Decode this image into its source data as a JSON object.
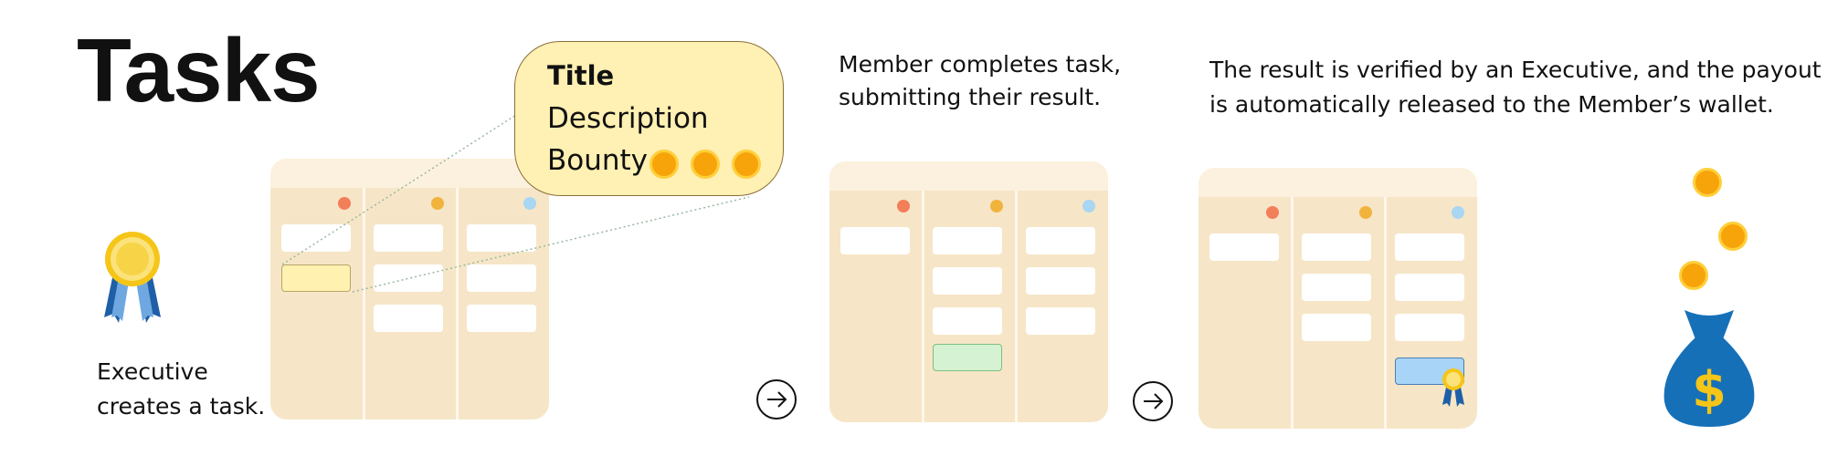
{
  "title": "Tasks",
  "step1": {
    "caption_line1": "Executive",
    "caption_line2": "creates a task."
  },
  "popup": {
    "title": "Title",
    "description": "Description",
    "bounty": "Bounty"
  },
  "step2": {
    "caption_line1": "Member completes task,",
    "caption_line2": "submitting their result."
  },
  "step3": {
    "caption_line1": "The result is verified by an Executive, and the payout",
    "caption_line2": "is automatically released to the Member’s wallet."
  },
  "icons": {
    "award": "award-ribbon-icon",
    "arrow": "arrow-right-circle-icon",
    "money_bag": "money-bag-dollar-icon",
    "coin": "coin-icon"
  },
  "colors": {
    "board": "#f6e6c7",
    "dot_red": "#f37e5a",
    "dot_yellow": "#f2b33d",
    "dot_blue": "#a9d6f2",
    "coin": "#f7a40b",
    "money_bag": "#1570b8"
  }
}
